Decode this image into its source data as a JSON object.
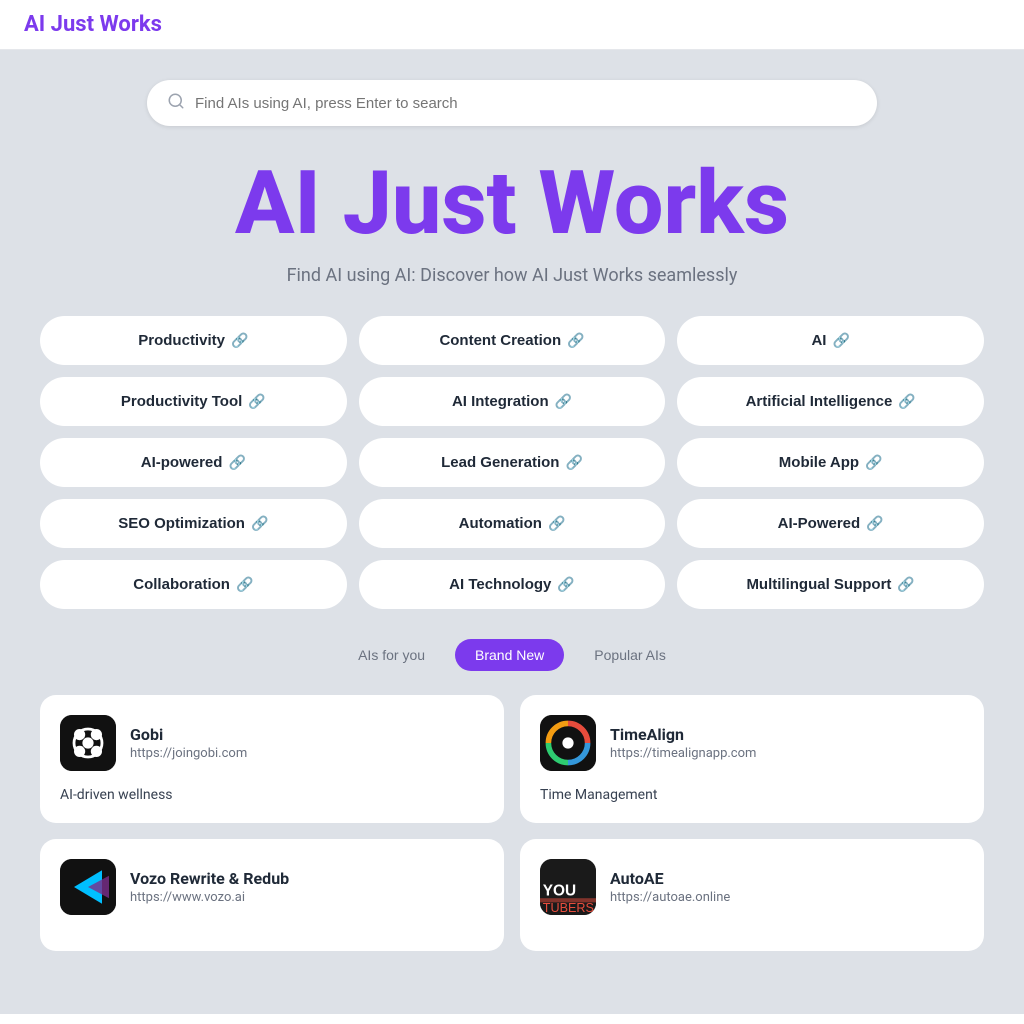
{
  "header": {
    "title": "AI Just Works"
  },
  "search": {
    "placeholder": "Find AIs using AI, press Enter to search"
  },
  "hero": {
    "title": "AI Just Works",
    "subtitle": "Find AI using AI: Discover how AI Just Works seamlessly"
  },
  "tags": [
    {
      "id": "productivity",
      "label": "Productivity"
    },
    {
      "id": "content-creation",
      "label": "Content Creation"
    },
    {
      "id": "ai",
      "label": "AI"
    },
    {
      "id": "productivity-tool",
      "label": "Productivity Tool"
    },
    {
      "id": "ai-integration",
      "label": "AI Integration"
    },
    {
      "id": "artificial-intelligence",
      "label": "Artificial Intelligence"
    },
    {
      "id": "ai-powered",
      "label": "AI-powered"
    },
    {
      "id": "lead-generation",
      "label": "Lead Generation"
    },
    {
      "id": "mobile-app",
      "label": "Mobile App"
    },
    {
      "id": "seo-optimization",
      "label": "SEO Optimization"
    },
    {
      "id": "automation",
      "label": "Automation"
    },
    {
      "id": "ai-powered-2",
      "label": "AI-Powered"
    },
    {
      "id": "collaboration",
      "label": "Collaboration"
    },
    {
      "id": "ai-technology",
      "label": "AI Technology"
    },
    {
      "id": "multilingual-support",
      "label": "Multilingual Support"
    }
  ],
  "filter_tabs": [
    {
      "id": "ais-for-you",
      "label": "AIs for you",
      "active": false
    },
    {
      "id": "brand-new",
      "label": "Brand New",
      "active": true
    },
    {
      "id": "popular-ais",
      "label": "Popular AIs",
      "active": false
    }
  ],
  "cards": [
    {
      "id": "gobi",
      "name": "Gobi",
      "url": "https://joingobi.com",
      "description": "AI-driven wellness",
      "logo_type": "gobi"
    },
    {
      "id": "timealign",
      "name": "TimeAlign",
      "url": "https://timealignapp.com",
      "description": "Time Management",
      "logo_type": "timealign"
    },
    {
      "id": "vozo",
      "name": "Vozo Rewrite & Redub",
      "url": "https://www.vozo.ai",
      "description": "",
      "logo_type": "vozo"
    },
    {
      "id": "autoae",
      "name": "AutoAE",
      "url": "https://autoae.online",
      "description": "",
      "logo_type": "autoae"
    }
  ]
}
